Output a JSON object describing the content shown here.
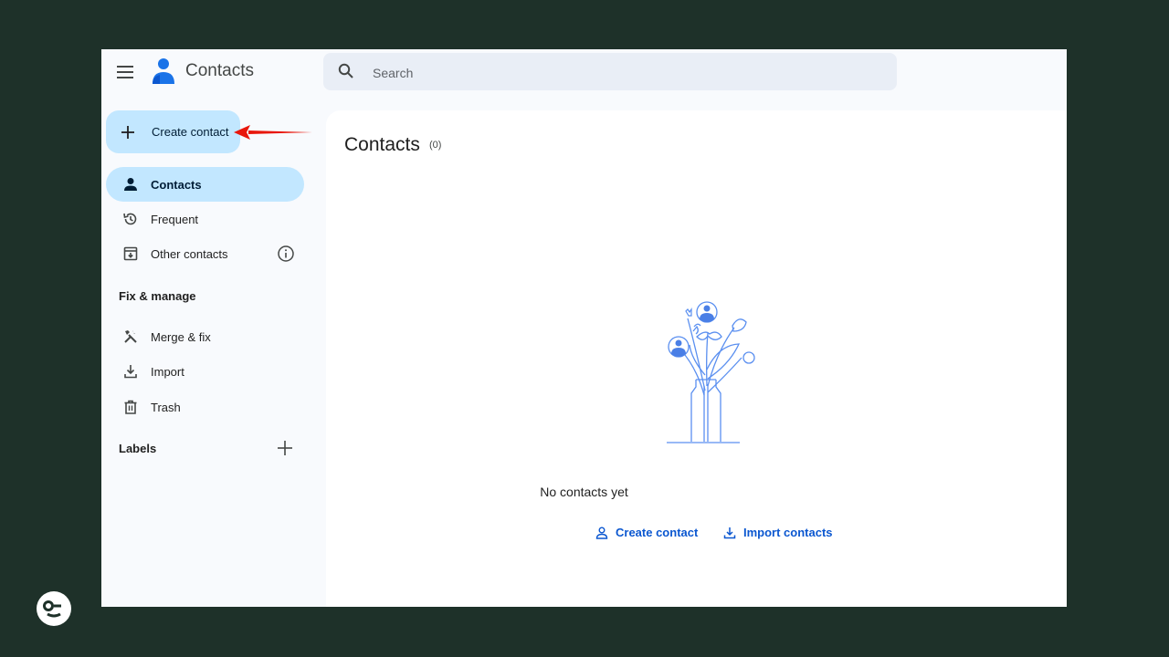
{
  "app": {
    "title": "Contacts"
  },
  "search": {
    "placeholder": "Search"
  },
  "create_button": {
    "label": "Create contact"
  },
  "sidebar": {
    "items": [
      {
        "label": "Contacts",
        "icon": "person-icon",
        "active": true
      },
      {
        "label": "Frequent",
        "icon": "history-icon"
      },
      {
        "label": "Other contacts",
        "icon": "archive-icon"
      }
    ],
    "fix_section": "Fix & manage",
    "fix_items": [
      {
        "label": "Merge & fix",
        "icon": "tools-icon"
      },
      {
        "label": "Import",
        "icon": "download-icon"
      },
      {
        "label": "Trash",
        "icon": "trash-icon"
      }
    ],
    "labels_section": "Labels"
  },
  "main": {
    "title": "Contacts",
    "count": "(0)",
    "empty_text": "No contacts yet",
    "create_link": "Create contact",
    "import_link": "Import contacts"
  },
  "colors": {
    "background": "#1e3129",
    "accent": "#0b57d0",
    "selected": "#c2e7ff",
    "arrow": "#e8170c"
  }
}
